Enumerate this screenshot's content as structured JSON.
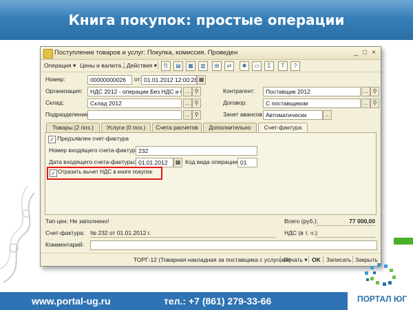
{
  "slide": {
    "title": "Книга покупок: простые операции",
    "website": "www.portal-ug.ru",
    "phone": "тел.: +7 (861) 279-33-66",
    "logo_text": "ПОРТАЛ ЮГ"
  },
  "window": {
    "title": "Поступление товаров и услуг: Покупка, комиссия. Проведен",
    "controls": [
      "_",
      "□",
      "×"
    ]
  },
  "toolbar": {
    "operation": "Операция",
    "prices": "Цены и валюта...",
    "actions": "Действия"
  },
  "header": {
    "number_label": "Номер:",
    "number_value": "00000000026",
    "from_label": "от:",
    "date_value": "01.01.2012 12:00:28",
    "org_label": "Организация:",
    "org_value": "НДС 2012 - операции Без НДС и 0%",
    "warehouse_label": "Склад:",
    "warehouse_value": "Склад 2012",
    "division_label": "Подразделение:",
    "division_value": "",
    "counterparty_label": "Контрагент:",
    "counterparty_value": "Поставщик 2012",
    "contract_label": "Договор:",
    "contract_value": "С поставщиком",
    "advance_label": "Зачет авансов:",
    "advance_value": "Автоматически"
  },
  "tabs": [
    {
      "label": "Товары (2 поз.)",
      "active": false
    },
    {
      "label": "Услуги (0 поз.)",
      "active": false
    },
    {
      "label": "Счета расчетов",
      "active": false
    },
    {
      "label": "Дополнительно",
      "active": false
    },
    {
      "label": "Счет-фактура",
      "active": true
    }
  ],
  "invoice_tab": {
    "presented_label": "Предъявлен счет-фактура",
    "presented_checked": true,
    "in_number_label": "Номер входящего счета-фактуры:",
    "in_number_value": "232",
    "in_date_label": "Дата входящего счета-фактуры:",
    "in_date_value": "01.01.2012",
    "op_code_label": "Код вида операции:",
    "op_code_value": "01",
    "reflect_label": "Отразить вычет НДС в книге покупок",
    "reflect_checked": true
  },
  "summary": {
    "price_type_label": "Тип цен: Не заполнено!",
    "total_label": "Всего (руб.):",
    "total_value": "77 000,00",
    "invoice_label": "Счет-фактура:",
    "invoice_value": "№ 232 от 01.01.2012 г.",
    "vat_label": "НДС (в т. ч.):",
    "vat_value": "",
    "comment_label": "Комментарий:",
    "comment_value": ""
  },
  "footer": {
    "torg": "ТОРГ-12 (Товарная накладная за поставщика с услугами)",
    "print": "Печать",
    "ok": "OK",
    "write": "Записать",
    "close": "Закрыть"
  },
  "colors": {
    "header_blue": "#2a6fa6",
    "window_bg": "#f4efd9",
    "highlight_red": "#e01818",
    "bottom_bar": "#2e73b3"
  }
}
